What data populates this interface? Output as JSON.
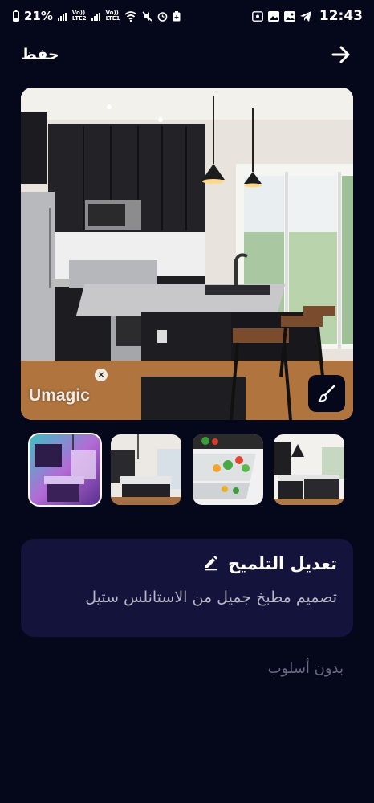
{
  "status_bar": {
    "battery": "21%",
    "net1_top": "Vo))",
    "net1_bottom": "LTE2",
    "net2_top": "Vo))",
    "net2_bottom": "LTE1",
    "time": "12:43"
  },
  "header": {
    "save_label": "حفظ",
    "forward_icon": "arrow-right-icon"
  },
  "main_image": {
    "watermark": "Umagic",
    "brush_icon": "brush-icon"
  },
  "thumbnails": [
    {
      "name": "purple-kitchen",
      "selected": true
    },
    {
      "name": "kitchen-island"
    },
    {
      "name": "drawer-vegetables"
    },
    {
      "name": "dark-kitchen"
    }
  ],
  "prompt": {
    "title": "تعديل التلميح",
    "edit_icon": "pencil-icon",
    "text": "تصميم مطبخ جميل من الاستانلس ستيل"
  },
  "style": {
    "label": "بدون أسلوب"
  },
  "colors": {
    "background": "#05071b",
    "card": "#14133c",
    "muted_text": "#6b6a80"
  }
}
